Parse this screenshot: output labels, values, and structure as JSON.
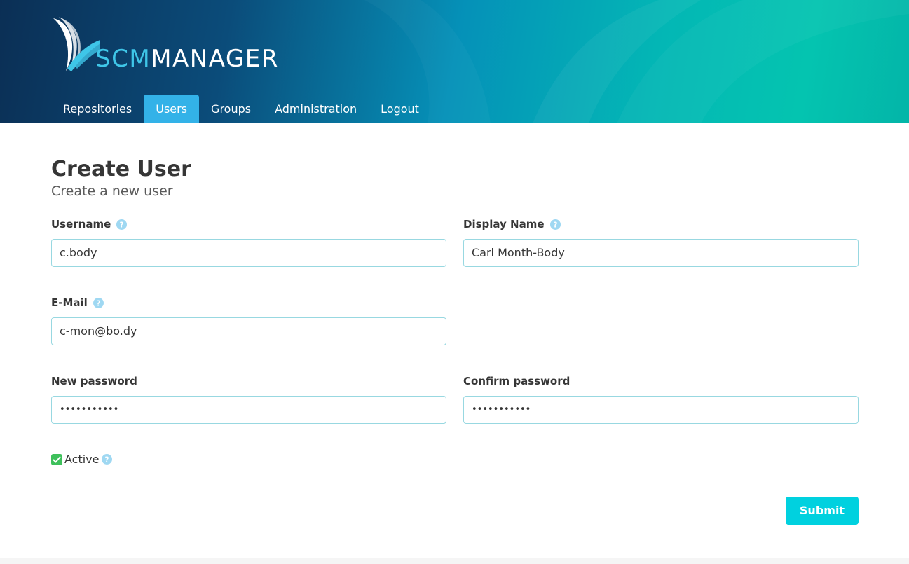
{
  "brand": {
    "prefix": "SCM",
    "suffix": "MANAGER"
  },
  "nav": {
    "items": [
      {
        "label": "Repositories",
        "active": false
      },
      {
        "label": "Users",
        "active": true
      },
      {
        "label": "Groups",
        "active": false
      },
      {
        "label": "Administration",
        "active": false
      },
      {
        "label": "Logout",
        "active": false
      }
    ]
  },
  "page": {
    "title": "Create User",
    "subtitle": "Create a new user"
  },
  "form": {
    "username": {
      "label": "Username",
      "value": "c.body"
    },
    "display_name": {
      "label": "Display Name",
      "value": "Carl Month-Body"
    },
    "email": {
      "label": "E-Mail",
      "value": "c-mon@bo.dy"
    },
    "new_password": {
      "label": "New password",
      "value": "•••••••••••"
    },
    "confirm_password": {
      "label": "Confirm password",
      "value": "•••••••••••"
    },
    "active": {
      "label": "Active",
      "checked": true
    },
    "submit_label": "Submit"
  },
  "colors": {
    "accent": "#33b2e8",
    "submit": "#00d1df",
    "checkbox": "#3ec05b",
    "input_border": "#98d8e1"
  }
}
